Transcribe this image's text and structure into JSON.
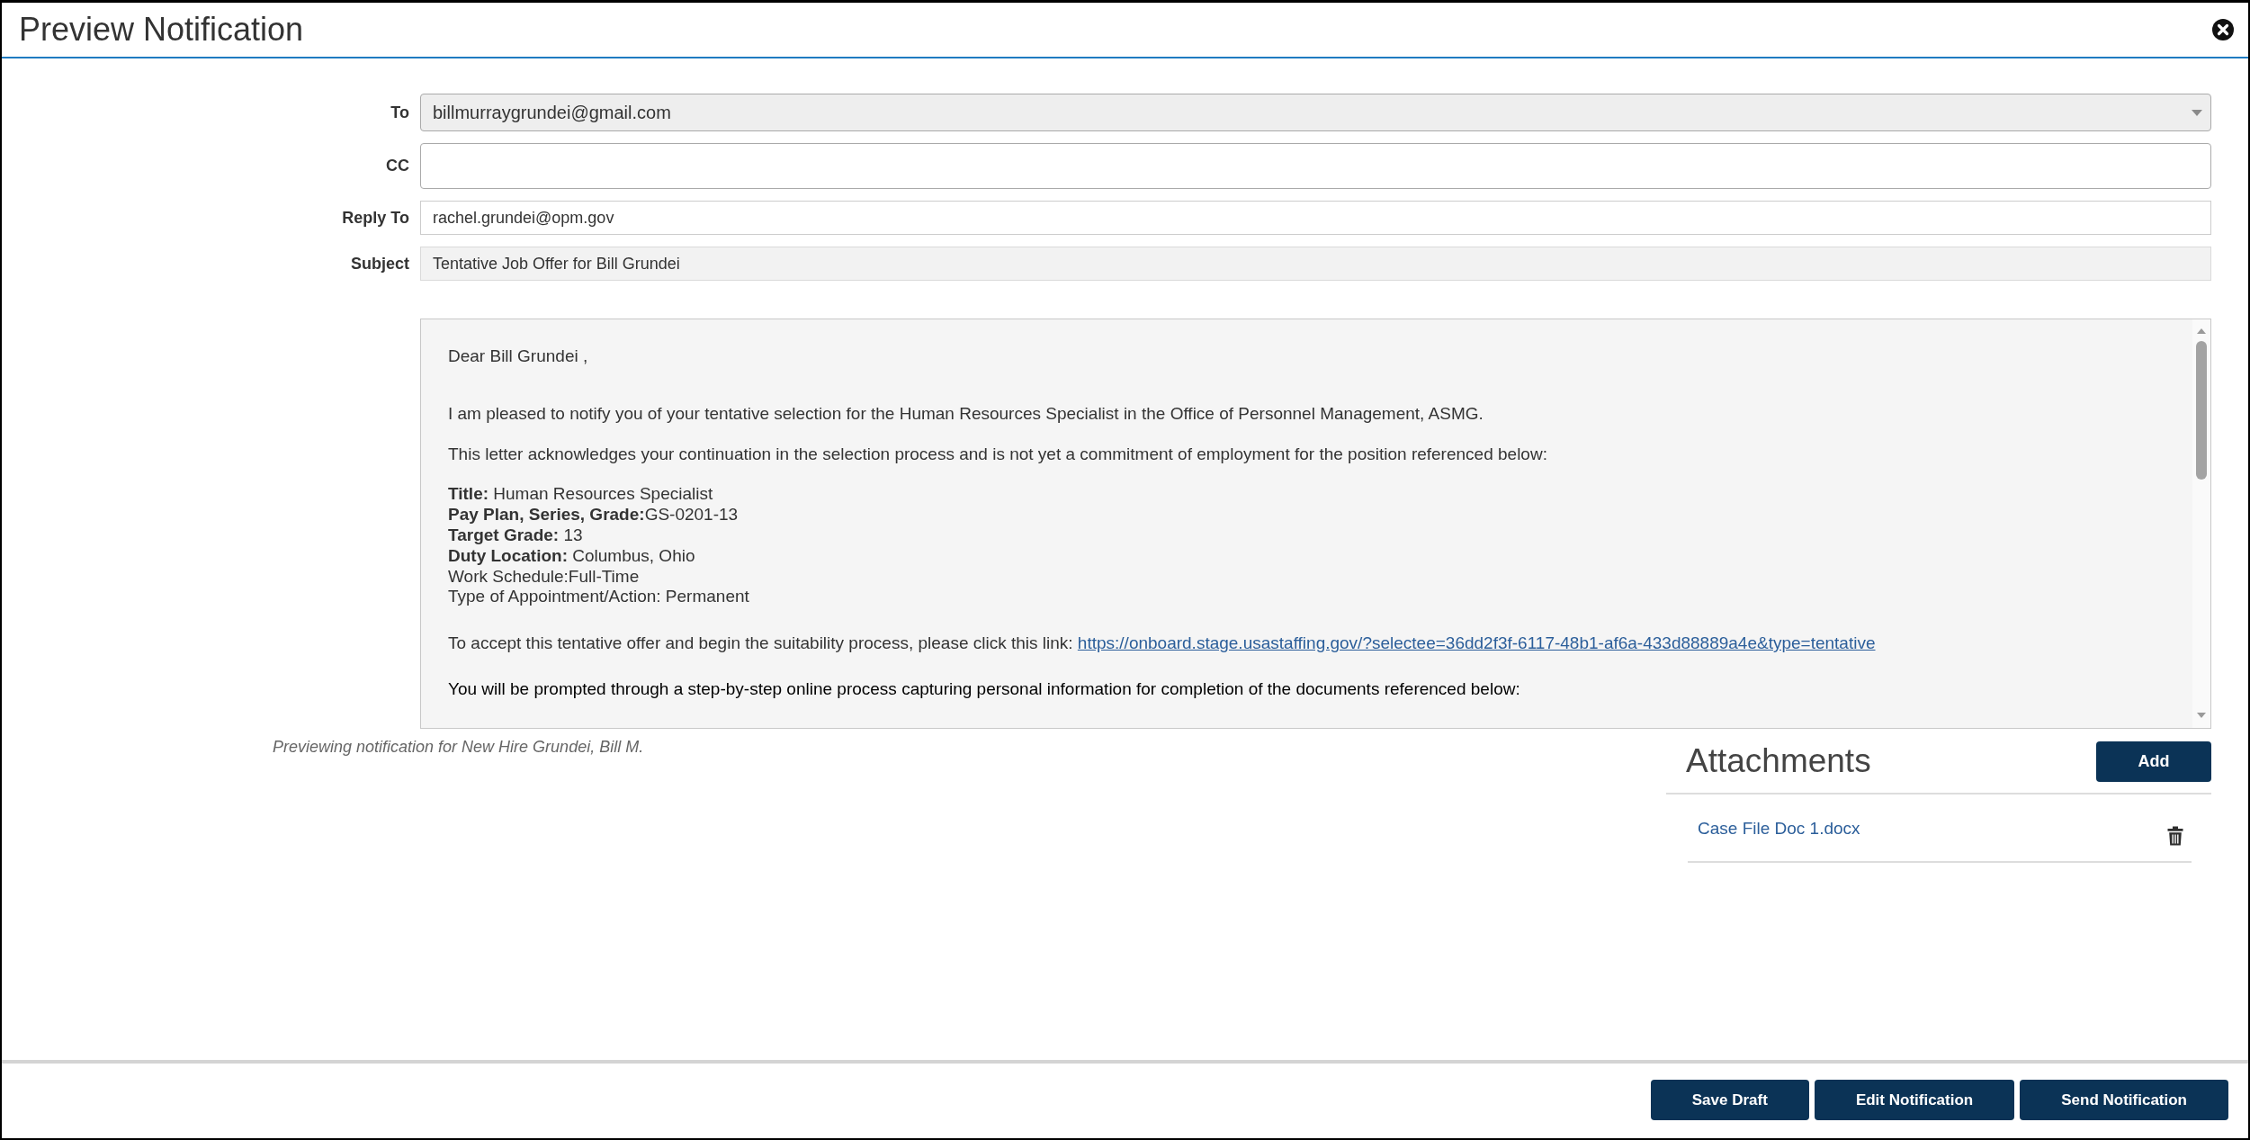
{
  "window": {
    "title": "Preview Notification"
  },
  "fields": [
    {
      "kind": "select",
      "label": "To",
      "value": "billmurraygrundei@gmail.com"
    },
    {
      "kind": "tags",
      "label": "CC"
    },
    {
      "kind": "text",
      "label": "Reply To",
      "value": "rachel.grundei@opm.gov"
    },
    {
      "kind": "readonly",
      "label": "Subject",
      "value": "Tentative Job Offer for Bill Grundei"
    }
  ],
  "message": {
    "blocks": [
      {
        "kind": "greeting",
        "text": "Dear Bill Grundei ,"
      },
      {
        "kind": "paragraph",
        "text": "I am pleased to notify you of your tentative selection for the Human Resources Specialist in the Office of Personnel Management, ASMG."
      },
      {
        "kind": "paragraph",
        "text": "This letter acknowledges your continuation in the selection process and is not yet a commitment of employment for the position referenced below:"
      },
      {
        "kind": "details",
        "lines": [
          "**Title:** Human Resources Specialist",
          "**Pay Plan, Series, Grade:**GS-0201-13",
          "**Target Grade:** 13",
          "**Duty Location:** Columbus, Ohio",
          "Work Schedule:Full-Time",
          "Type of Appointment/Action: Permanent"
        ]
      },
      {
        "kind": "link",
        "text": "To accept this tentative offer and begin the suitability process, please click this link:",
        "link": "https://onboard.stage.usastaffing.gov/?selectee=36dd2f3f-6117-48b1-af6a-433d88889a4e&type=tentative"
      },
      {
        "kind": "notice",
        "text": "You will be prompted through a step-by-step online process capturing personal information for completion of the documents referenced below:"
      }
    ]
  },
  "note": "Previewing notification for New Hire Grundei, Bill M.",
  "attachments": {
    "title": "Attachments",
    "add_button": "Add",
    "items": [
      {
        "name": "Case File Doc 1.docx"
      }
    ]
  },
  "footer": {
    "buttons": [
      "Save Draft",
      "Edit Notification",
      "Send Notification"
    ]
  }
}
